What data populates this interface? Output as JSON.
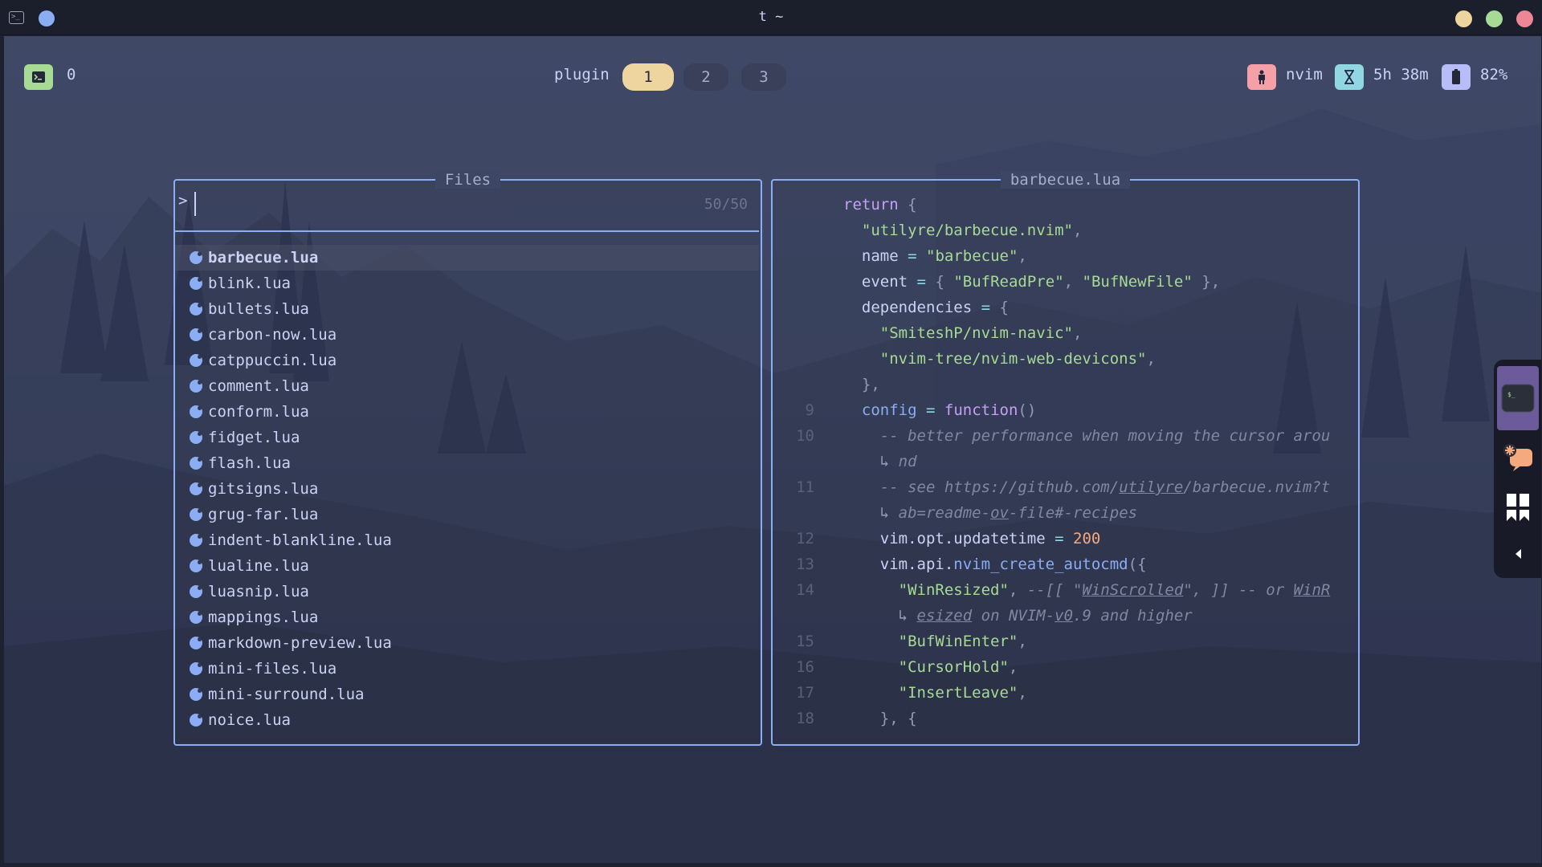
{
  "window": {
    "title": "t ~"
  },
  "statusbar": {
    "session_count": "0",
    "workspace_label": "plugin",
    "workspaces": [
      "1",
      "2",
      "3"
    ],
    "active_workspace": "1",
    "app_name": "nvim",
    "uptime": "5h 38m",
    "battery": "82%",
    "colors": {
      "terminal": "#a6da95",
      "active_ws": "#eed49f",
      "app": "#f5a0a7",
      "uptime": "#91d7e3",
      "battery": "#b7bdf8"
    }
  },
  "files_panel": {
    "title": "Files",
    "prompt": ">",
    "count": "50/50",
    "files": [
      "barbecue.lua",
      "blink.lua",
      "bullets.lua",
      "carbon-now.lua",
      "catppuccin.lua",
      "comment.lua",
      "conform.lua",
      "fidget.lua",
      "flash.lua",
      "gitsigns.lua",
      "grug-far.lua",
      "indent-blankline.lua",
      "lualine.lua",
      "luasnip.lua",
      "mappings.lua",
      "markdown-preview.lua",
      "mini-files.lua",
      "mini-surround.lua",
      "noice.lua"
    ],
    "selected": "barbecue.lua"
  },
  "preview_panel": {
    "title": "barbecue.lua",
    "line_numbers": [
      "",
      "",
      "",
      "",
      "",
      "",
      "",
      "",
      "9",
      "10",
      "",
      "11",
      "",
      "12",
      "13",
      "14",
      "",
      "15",
      "16",
      "17",
      "18"
    ],
    "code": {
      "l1_kw": "return",
      "l1_p": " {",
      "l2_s": "\"utilyre/barbecue.nvim\"",
      "l3_id": "name",
      "l3_s": "\"barbecue\"",
      "l4_id": "event",
      "l4_s1": "\"BufReadPre\"",
      "l4_s2": "\"BufNewFile\"",
      "l5_id": "dependencies",
      "l6_s": "\"SmiteshP/nvim-navic\"",
      "l7_s": "\"nvim-tree/nvim-web-devicons\"",
      "l8_p": "},",
      "l9_id": "config",
      "l9_kw": "function",
      "l10_c": "-- better performance when moving the cursor arou",
      "l10w": "nd",
      "l11_c1": "-- see https://github.com/",
      "l11_u": "utilyre",
      "l11_c2": "/barbecue.nvim?t",
      "l11w1": "ab=readme-",
      "l11w_u": "ov",
      "l11w2": "-file#-recipes",
      "l12_id": "vim.opt.updatetime",
      "l12_n": "200",
      "l13_id": "vim.api.",
      "l13_fn": "nvim_create_autocmd",
      "l14_s": "\"WinResized\"",
      "l14_c1": "--[[ \"",
      "l14_u1": "WinScrolled",
      "l14_c2": "\", ]] -- or ",
      "l14_u2": "WinR",
      "l14w_u1": "esized",
      "l14w_c1": " on NVIM-",
      "l14w_u2": "v0",
      "l14w_c2": ".9 and higher",
      "l15_s": "\"BufWinEnter\"",
      "l16_s": "\"CursorHold\"",
      "l17_s": "\"InsertLeave\"",
      "l18_p": "}, {"
    }
  },
  "dock": {
    "items": [
      "terminal-app",
      "chat-app",
      "bookmark-app",
      "collapse"
    ]
  }
}
